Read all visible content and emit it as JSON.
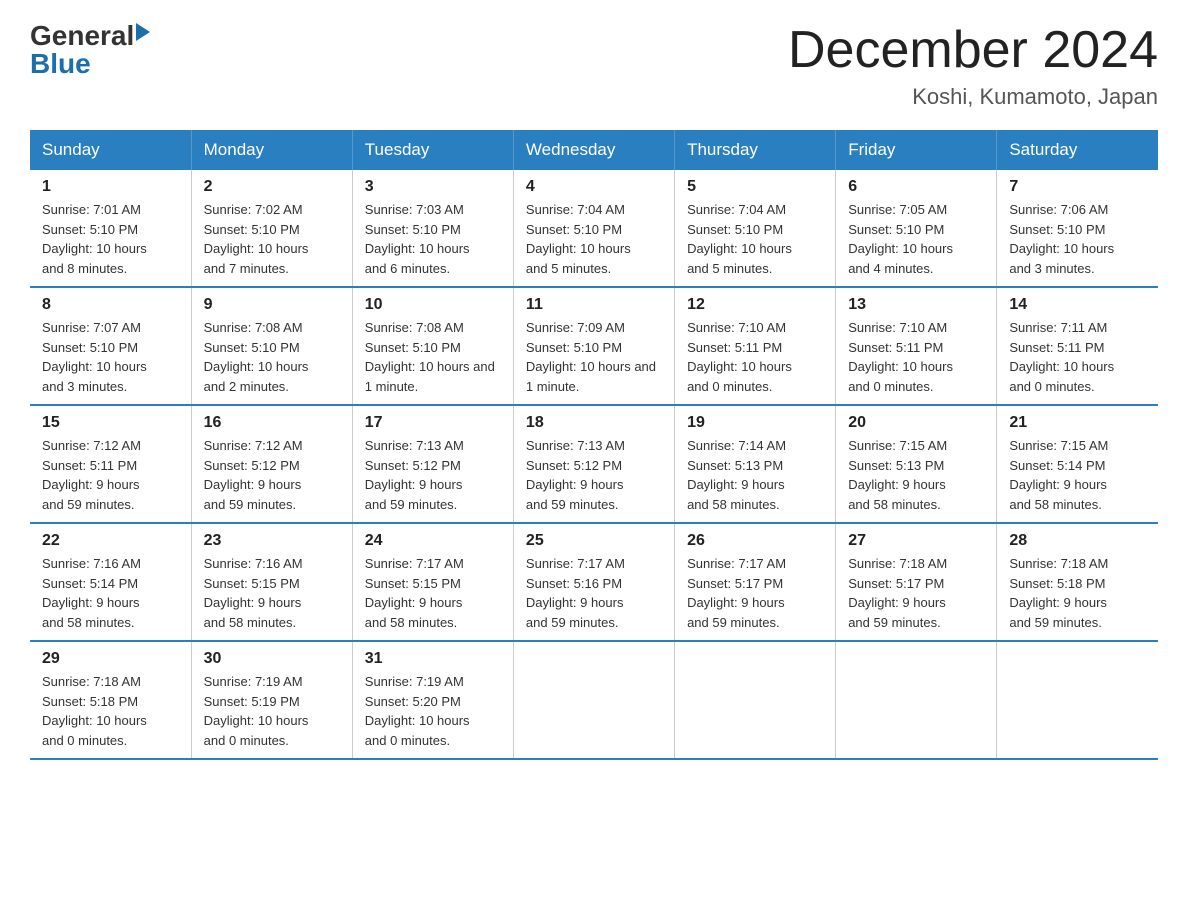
{
  "header": {
    "logo": {
      "line1": "General",
      "line2": "Blue"
    },
    "title": "December 2024",
    "location": "Koshi, Kumamoto, Japan"
  },
  "days_of_week": [
    "Sunday",
    "Monday",
    "Tuesday",
    "Wednesday",
    "Thursday",
    "Friday",
    "Saturday"
  ],
  "weeks": [
    [
      {
        "day": "1",
        "sunrise": "7:01 AM",
        "sunset": "5:10 PM",
        "daylight": "10 hours and 8 minutes."
      },
      {
        "day": "2",
        "sunrise": "7:02 AM",
        "sunset": "5:10 PM",
        "daylight": "10 hours and 7 minutes."
      },
      {
        "day": "3",
        "sunrise": "7:03 AM",
        "sunset": "5:10 PM",
        "daylight": "10 hours and 6 minutes."
      },
      {
        "day": "4",
        "sunrise": "7:04 AM",
        "sunset": "5:10 PM",
        "daylight": "10 hours and 5 minutes."
      },
      {
        "day": "5",
        "sunrise": "7:04 AM",
        "sunset": "5:10 PM",
        "daylight": "10 hours and 5 minutes."
      },
      {
        "day": "6",
        "sunrise": "7:05 AM",
        "sunset": "5:10 PM",
        "daylight": "10 hours and 4 minutes."
      },
      {
        "day": "7",
        "sunrise": "7:06 AM",
        "sunset": "5:10 PM",
        "daylight": "10 hours and 3 minutes."
      }
    ],
    [
      {
        "day": "8",
        "sunrise": "7:07 AM",
        "sunset": "5:10 PM",
        "daylight": "10 hours and 3 minutes."
      },
      {
        "day": "9",
        "sunrise": "7:08 AM",
        "sunset": "5:10 PM",
        "daylight": "10 hours and 2 minutes."
      },
      {
        "day": "10",
        "sunrise": "7:08 AM",
        "sunset": "5:10 PM",
        "daylight": "10 hours and 1 minute."
      },
      {
        "day": "11",
        "sunrise": "7:09 AM",
        "sunset": "5:10 PM",
        "daylight": "10 hours and 1 minute."
      },
      {
        "day": "12",
        "sunrise": "7:10 AM",
        "sunset": "5:11 PM",
        "daylight": "10 hours and 0 minutes."
      },
      {
        "day": "13",
        "sunrise": "7:10 AM",
        "sunset": "5:11 PM",
        "daylight": "10 hours and 0 minutes."
      },
      {
        "day": "14",
        "sunrise": "7:11 AM",
        "sunset": "5:11 PM",
        "daylight": "10 hours and 0 minutes."
      }
    ],
    [
      {
        "day": "15",
        "sunrise": "7:12 AM",
        "sunset": "5:11 PM",
        "daylight": "9 hours and 59 minutes."
      },
      {
        "day": "16",
        "sunrise": "7:12 AM",
        "sunset": "5:12 PM",
        "daylight": "9 hours and 59 minutes."
      },
      {
        "day": "17",
        "sunrise": "7:13 AM",
        "sunset": "5:12 PM",
        "daylight": "9 hours and 59 minutes."
      },
      {
        "day": "18",
        "sunrise": "7:13 AM",
        "sunset": "5:12 PM",
        "daylight": "9 hours and 59 minutes."
      },
      {
        "day": "19",
        "sunrise": "7:14 AM",
        "sunset": "5:13 PM",
        "daylight": "9 hours and 58 minutes."
      },
      {
        "day": "20",
        "sunrise": "7:15 AM",
        "sunset": "5:13 PM",
        "daylight": "9 hours and 58 minutes."
      },
      {
        "day": "21",
        "sunrise": "7:15 AM",
        "sunset": "5:14 PM",
        "daylight": "9 hours and 58 minutes."
      }
    ],
    [
      {
        "day": "22",
        "sunrise": "7:16 AM",
        "sunset": "5:14 PM",
        "daylight": "9 hours and 58 minutes."
      },
      {
        "day": "23",
        "sunrise": "7:16 AM",
        "sunset": "5:15 PM",
        "daylight": "9 hours and 58 minutes."
      },
      {
        "day": "24",
        "sunrise": "7:17 AM",
        "sunset": "5:15 PM",
        "daylight": "9 hours and 58 minutes."
      },
      {
        "day": "25",
        "sunrise": "7:17 AM",
        "sunset": "5:16 PM",
        "daylight": "9 hours and 59 minutes."
      },
      {
        "day": "26",
        "sunrise": "7:17 AM",
        "sunset": "5:17 PM",
        "daylight": "9 hours and 59 minutes."
      },
      {
        "day": "27",
        "sunrise": "7:18 AM",
        "sunset": "5:17 PM",
        "daylight": "9 hours and 59 minutes."
      },
      {
        "day": "28",
        "sunrise": "7:18 AM",
        "sunset": "5:18 PM",
        "daylight": "9 hours and 59 minutes."
      }
    ],
    [
      {
        "day": "29",
        "sunrise": "7:18 AM",
        "sunset": "5:18 PM",
        "daylight": "10 hours and 0 minutes."
      },
      {
        "day": "30",
        "sunrise": "7:19 AM",
        "sunset": "5:19 PM",
        "daylight": "10 hours and 0 minutes."
      },
      {
        "day": "31",
        "sunrise": "7:19 AM",
        "sunset": "5:20 PM",
        "daylight": "10 hours and 0 minutes."
      },
      null,
      null,
      null,
      null
    ]
  ],
  "labels": {
    "sunrise": "Sunrise:",
    "sunset": "Sunset:",
    "daylight": "Daylight:"
  }
}
